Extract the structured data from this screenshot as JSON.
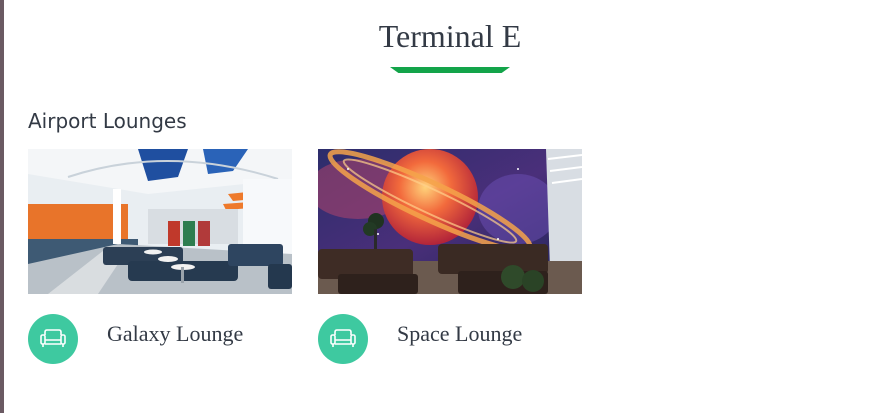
{
  "page": {
    "title": "Terminal E",
    "accent_color": "#13a44a"
  },
  "section": {
    "title": "Airport Lounges"
  },
  "lounges": [
    {
      "name": "Galaxy Lounge",
      "icon": "sofa-icon",
      "icon_color": "#3ec9a0"
    },
    {
      "name": "Space Lounge",
      "icon": "sofa-icon",
      "icon_color": "#3ec9a0"
    }
  ]
}
